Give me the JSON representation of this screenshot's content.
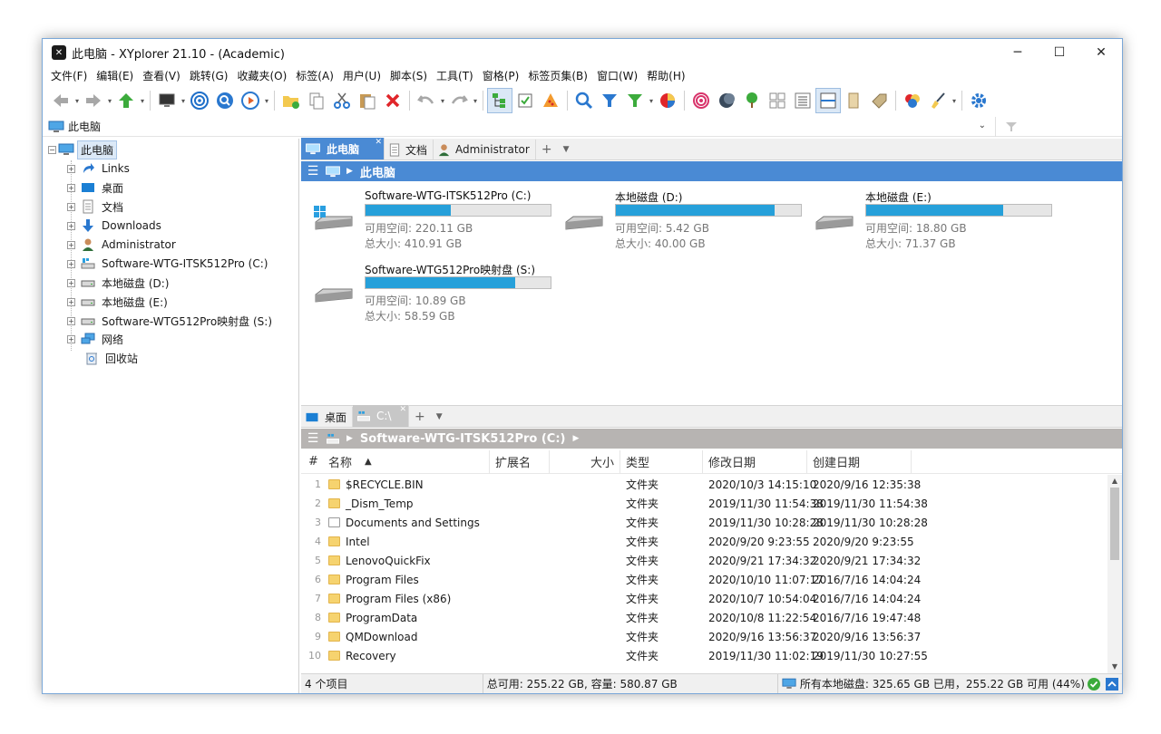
{
  "window": {
    "title": "此电脑 - XYplorer 21.10 - (Academic)",
    "minimize": "─",
    "maximize": "☐",
    "close": "✕"
  },
  "menu": [
    "文件(F)",
    "编辑(E)",
    "查看(V)",
    "跳转(G)",
    "收藏夹(O)",
    "标签(A)",
    "用户(U)",
    "脚本(S)",
    "工具(T)",
    "窗格(P)",
    "标签页集(B)",
    "窗口(W)",
    "帮助(H)"
  ],
  "address": {
    "path": "此电脑"
  },
  "tree": {
    "root": "此电脑",
    "items": [
      {
        "label": "Links",
        "icon": "links-icon"
      },
      {
        "label": "桌面",
        "icon": "desktop-icon"
      },
      {
        "label": "文档",
        "icon": "documents-icon"
      },
      {
        "label": "Downloads",
        "icon": "downloads-icon"
      },
      {
        "label": "Administrator",
        "icon": "user-icon"
      },
      {
        "label": "Software-WTG-ITSK512Pro (C:)",
        "icon": "system-drive-icon"
      },
      {
        "label": "本地磁盘 (D:)",
        "icon": "drive-icon"
      },
      {
        "label": "本地磁盘 (E:)",
        "icon": "drive-icon"
      },
      {
        "label": "Software-WTG512Pro映射盘 (S:)",
        "icon": "drive-icon"
      },
      {
        "label": "网络",
        "icon": "network-icon"
      },
      {
        "label": "回收站",
        "icon": "recycle-bin-icon"
      }
    ]
  },
  "pane1": {
    "tabs": [
      {
        "label": "此电脑",
        "active": true
      },
      {
        "label": "文档",
        "active": false
      },
      {
        "label": "Administrator",
        "active": false
      }
    ],
    "breadcrumb": "此电脑",
    "drives": [
      {
        "name": "Software-WTG-ITSK512Pro (C:)",
        "free": "可用空间: 220.11 GB",
        "total": "总大小: 410.91 GB",
        "used_fraction": 0.46,
        "system": true
      },
      {
        "name": "本地磁盘 (D:)",
        "free": "可用空间: 5.42 GB",
        "total": "总大小: 40.00 GB",
        "used_fraction": 0.86,
        "system": false
      },
      {
        "name": "本地磁盘 (E:)",
        "free": "可用空间: 18.80 GB",
        "total": "总大小: 71.37 GB",
        "used_fraction": 0.74,
        "system": false
      },
      {
        "name": "Software-WTG512Pro映射盘 (S:)",
        "free": "可用空间: 10.89 GB",
        "total": "总大小: 58.59 GB",
        "used_fraction": 0.81,
        "system": false
      }
    ]
  },
  "pane2": {
    "tabs": [
      {
        "label": "桌面",
        "active": false
      },
      {
        "label": "C:\\",
        "active": true
      }
    ],
    "breadcrumb": "Software-WTG-ITSK512Pro (C:)",
    "columns": {
      "num": "#",
      "name": "名称",
      "ext": "扩展名",
      "size": "大小",
      "type": "类型",
      "modified": "修改日期",
      "created": "创建日期"
    },
    "rows": [
      {
        "num": "1",
        "name": "$RECYCLE.BIN",
        "type": "文件夹",
        "modified": "2020/10/3 14:15:10",
        "created": "2020/9/16 12:35:38"
      },
      {
        "num": "2",
        "name": "_Dism_Temp",
        "type": "文件夹",
        "modified": "2019/11/30 11:54:38",
        "created": "2019/11/30 11:54:38"
      },
      {
        "num": "3",
        "name": "Documents and Settings",
        "type": "文件夹",
        "modified": "2019/11/30 10:28:28",
        "created": "2019/11/30 10:28:28"
      },
      {
        "num": "4",
        "name": "Intel",
        "type": "文件夹",
        "modified": "2020/9/20 9:23:55",
        "created": "2020/9/20 9:23:55"
      },
      {
        "num": "5",
        "name": "LenovoQuickFix",
        "type": "文件夹",
        "modified": "2020/9/21 17:34:32",
        "created": "2020/9/21 17:34:32"
      },
      {
        "num": "6",
        "name": "Program Files",
        "type": "文件夹",
        "modified": "2020/10/10 11:07:17",
        "created": "2016/7/16 14:04:24"
      },
      {
        "num": "7",
        "name": "Program Files (x86)",
        "type": "文件夹",
        "modified": "2020/10/7 10:54:04",
        "created": "2016/7/16 14:04:24"
      },
      {
        "num": "8",
        "name": "ProgramData",
        "type": "文件夹",
        "modified": "2020/10/8 11:22:54",
        "created": "2016/7/16 19:47:48"
      },
      {
        "num": "9",
        "name": "QMDownload",
        "type": "文件夹",
        "modified": "2020/9/16 13:56:37",
        "created": "2020/9/16 13:56:37"
      },
      {
        "num": "10",
        "name": "Recovery",
        "type": "文件夹",
        "modified": "2019/11/30 11:02:19",
        "created": "2019/11/30 10:27:55"
      }
    ]
  },
  "status": {
    "items": "4 个项目",
    "free": "总可用: 255.22 GB, 容量: 580.87 GB",
    "all_drives": "所有本地磁盘: 325.65 GB 已用，255.22 GB 可用 (44%)"
  },
  "colors": {
    "accent": "#4a8ad4",
    "drive_fill": "#26a0da",
    "inactive_crumb": "#b7b4b2"
  }
}
